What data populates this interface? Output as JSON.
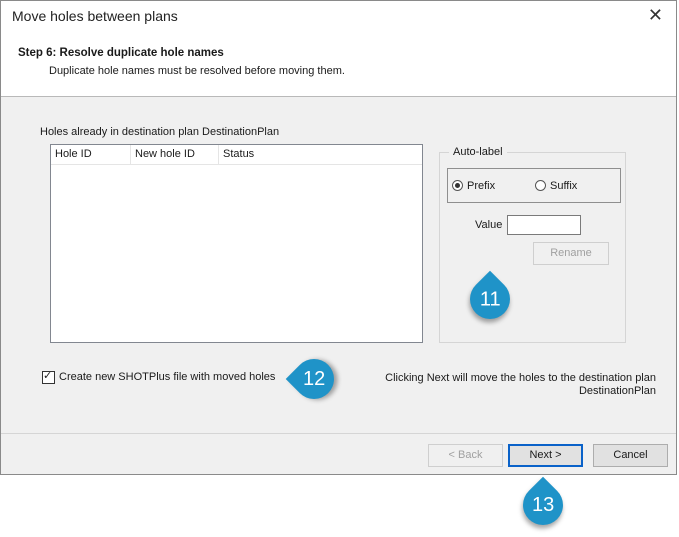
{
  "window": {
    "title": "Move holes between plans",
    "close_glyph": "✕"
  },
  "step": {
    "title": "Step 6: Resolve duplicate hole names",
    "description": "Duplicate hole names must be resolved before moving them."
  },
  "list": {
    "caption": "Holes already in destination plan DestinationPlan",
    "columns": [
      "Hole ID",
      "New hole ID",
      "Status"
    ]
  },
  "autolabel": {
    "legend": "Auto-label",
    "prefix_label": "Prefix",
    "suffix_label": "Suffix",
    "selected": "Prefix",
    "value_label": "Value",
    "value": "",
    "rename_label": "Rename"
  },
  "options": {
    "create_file_label": "Create new SHOTPlus file with moved holes",
    "create_file_checked": true
  },
  "info": {
    "line1": "Clicking Next will move the holes to the destination plan",
    "line2": "DestinationPlan"
  },
  "buttons": {
    "back": "< Back",
    "next": "Next >",
    "cancel": "Cancel"
  },
  "callouts": {
    "c11": "11",
    "c12": "12",
    "c13": "13",
    "color": "#1f93c8"
  },
  "icons": {
    "close": "close-icon",
    "check": "checkmark-icon"
  }
}
